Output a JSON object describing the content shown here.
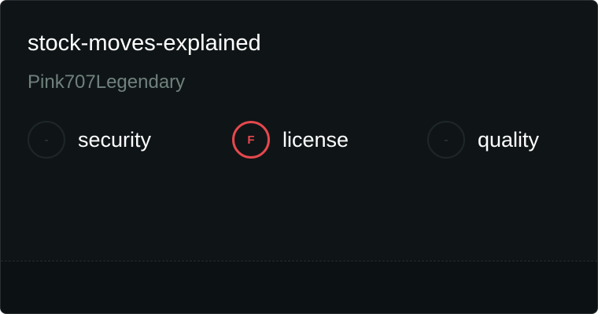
{
  "repo": {
    "name": "stock-moves-explained",
    "owner": "Pink707Legendary"
  },
  "metrics": [
    {
      "label": "security",
      "grade": "-",
      "status": "none"
    },
    {
      "label": "license",
      "grade": "F",
      "status": "fail"
    },
    {
      "label": "quality",
      "grade": "-",
      "status": "none"
    }
  ],
  "colors": {
    "background": "#0f1517",
    "footer": "#0c1113",
    "title": "#ffffff",
    "owner": "#70817c",
    "fail": "#e5484d",
    "none": "#1f2628"
  }
}
